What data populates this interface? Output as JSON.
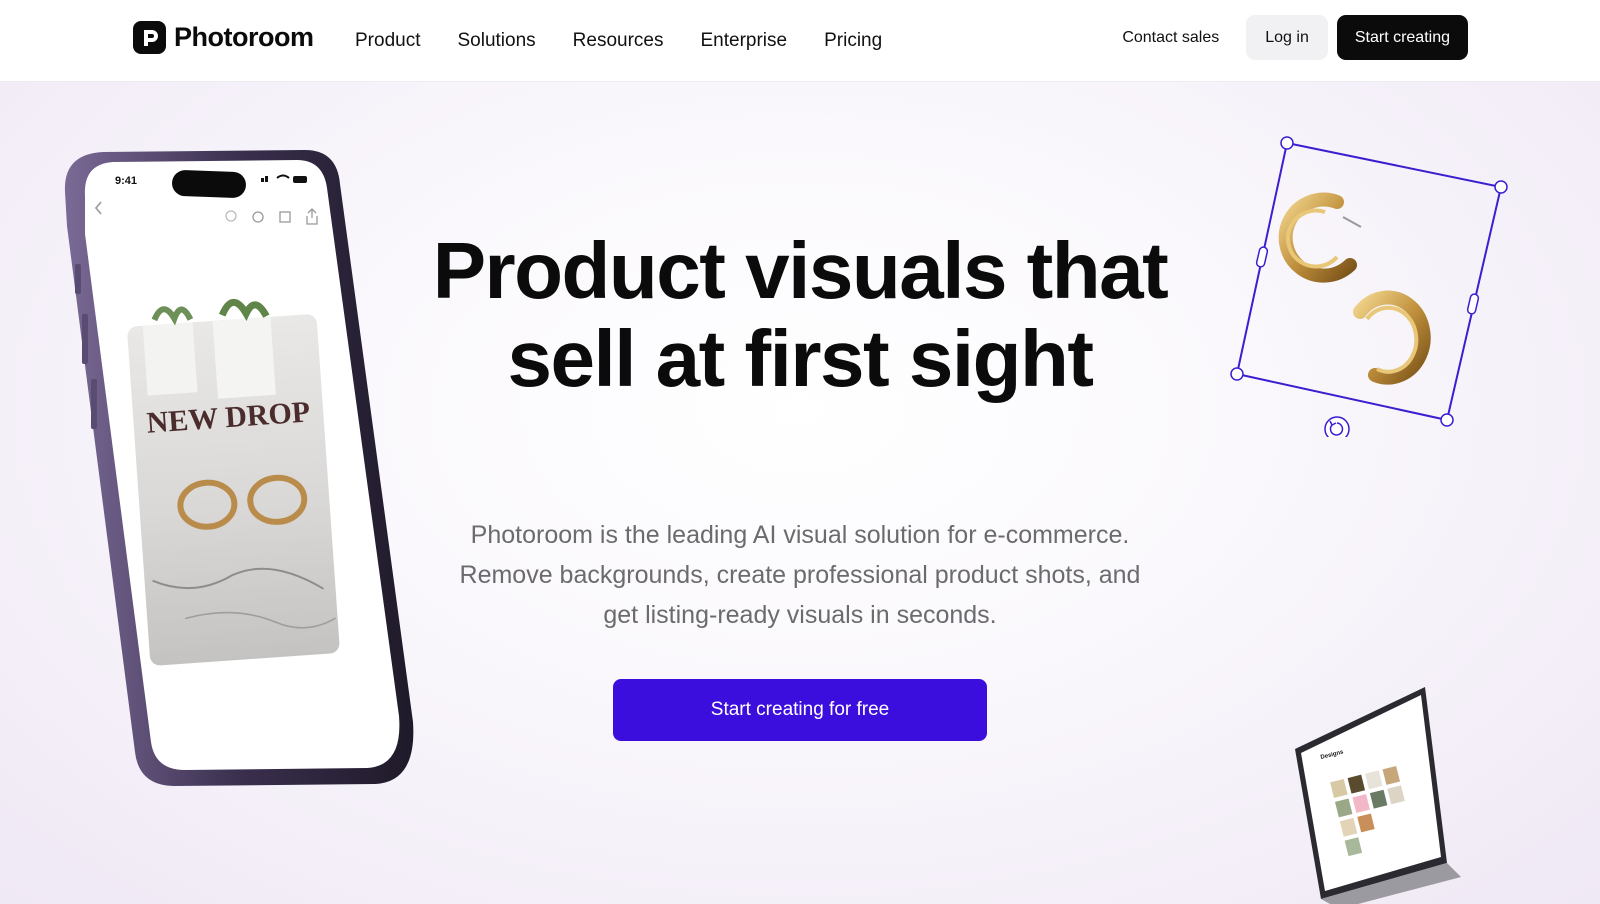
{
  "nav": {
    "brand": "Photoroom",
    "links": [
      "Product",
      "Solutions",
      "Resources",
      "Enterprise",
      "Pricing"
    ],
    "contact_label": "Contact sales",
    "login_label": "Log in",
    "start_label": "Start creating"
  },
  "hero": {
    "title": "Product visuals that sell at first sight",
    "subtitle": "Photoroom is the leading AI visual solution for e-commerce. Remove backgrounds, create professional product shots, and get listing-ready visuals in seconds.",
    "cta_label": "Start creating for free"
  },
  "phone": {
    "time": "9:41",
    "card_text": "NEW DROP"
  },
  "laptop": {
    "title": "Designs"
  },
  "colors": {
    "accent": "#3b0edd",
    "selection": "#3a1fd0",
    "dark": "#0b0b0b"
  }
}
